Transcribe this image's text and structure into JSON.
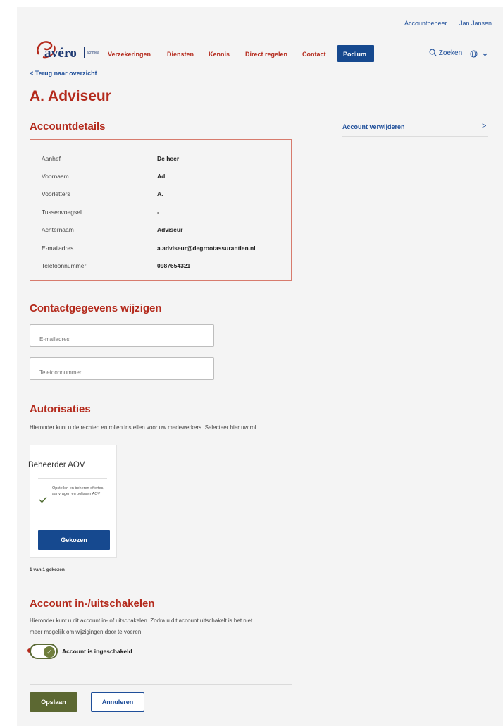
{
  "topbar": {
    "account_link": "Accountbeheer",
    "user_name": "Jan Jansen"
  },
  "logo": {
    "brand": "avéro",
    "sub": "achmea"
  },
  "nav": {
    "items": [
      "Verzekeringen",
      "Diensten",
      "Kennis",
      "Direct regelen",
      "Contact"
    ],
    "active": "Podium",
    "search_label": "Zoeken"
  },
  "back_link": "< Terug naar overzicht",
  "page_title": "A. Adviseur",
  "account_details": {
    "heading": "Accountdetails",
    "rows": [
      {
        "label": "Aanhef",
        "value": "De heer"
      },
      {
        "label": "Voornaam",
        "value": "Ad"
      },
      {
        "label": "Voorletters",
        "value": "A."
      },
      {
        "label": "Tussenvoegsel",
        "value": "-"
      },
      {
        "label": "Achternaam",
        "value": "Adviseur"
      },
      {
        "label": "E-mailadres",
        "value": "a.adviseur@degrootassurantien.nl"
      },
      {
        "label": "Telefoonnummer",
        "value": "0987654321"
      }
    ]
  },
  "side": {
    "delete_account": "Account verwijderen",
    "arrow": ">"
  },
  "contact": {
    "heading": "Contactgegevens wijzigen",
    "email_placeholder": "E-mailadres",
    "phone_placeholder": "Telefoonnummer"
  },
  "authorisations": {
    "heading": "Autorisaties",
    "description": "Hieronder kunt u de rechten en rollen instellen voor uw medewerkers. Selecteer hier uw rol.",
    "role_title": "Beheerder AOV",
    "role_description": "Opstellen en beheren offertes, aanvragen en polissen AOV",
    "role_button": "Gekozen",
    "count": "1 van 1 gekozen"
  },
  "account_toggle": {
    "heading": "Account in-/uitschakelen",
    "description_line1": "Hieronder kunt u dit account in- of uitschakelen. Zodra u dit account uitschakelt is het niet",
    "description_line2": "meer mogelijk om wijzigingen door te voeren.",
    "toggle_label": "Account is ingeschakeld",
    "enabled": true
  },
  "actions": {
    "save": "Opslaan",
    "cancel": "Annuleren"
  },
  "colors": {
    "brand_red": "#b42a1c",
    "brand_blue": "#16498f",
    "save_green": "#5c6832"
  }
}
